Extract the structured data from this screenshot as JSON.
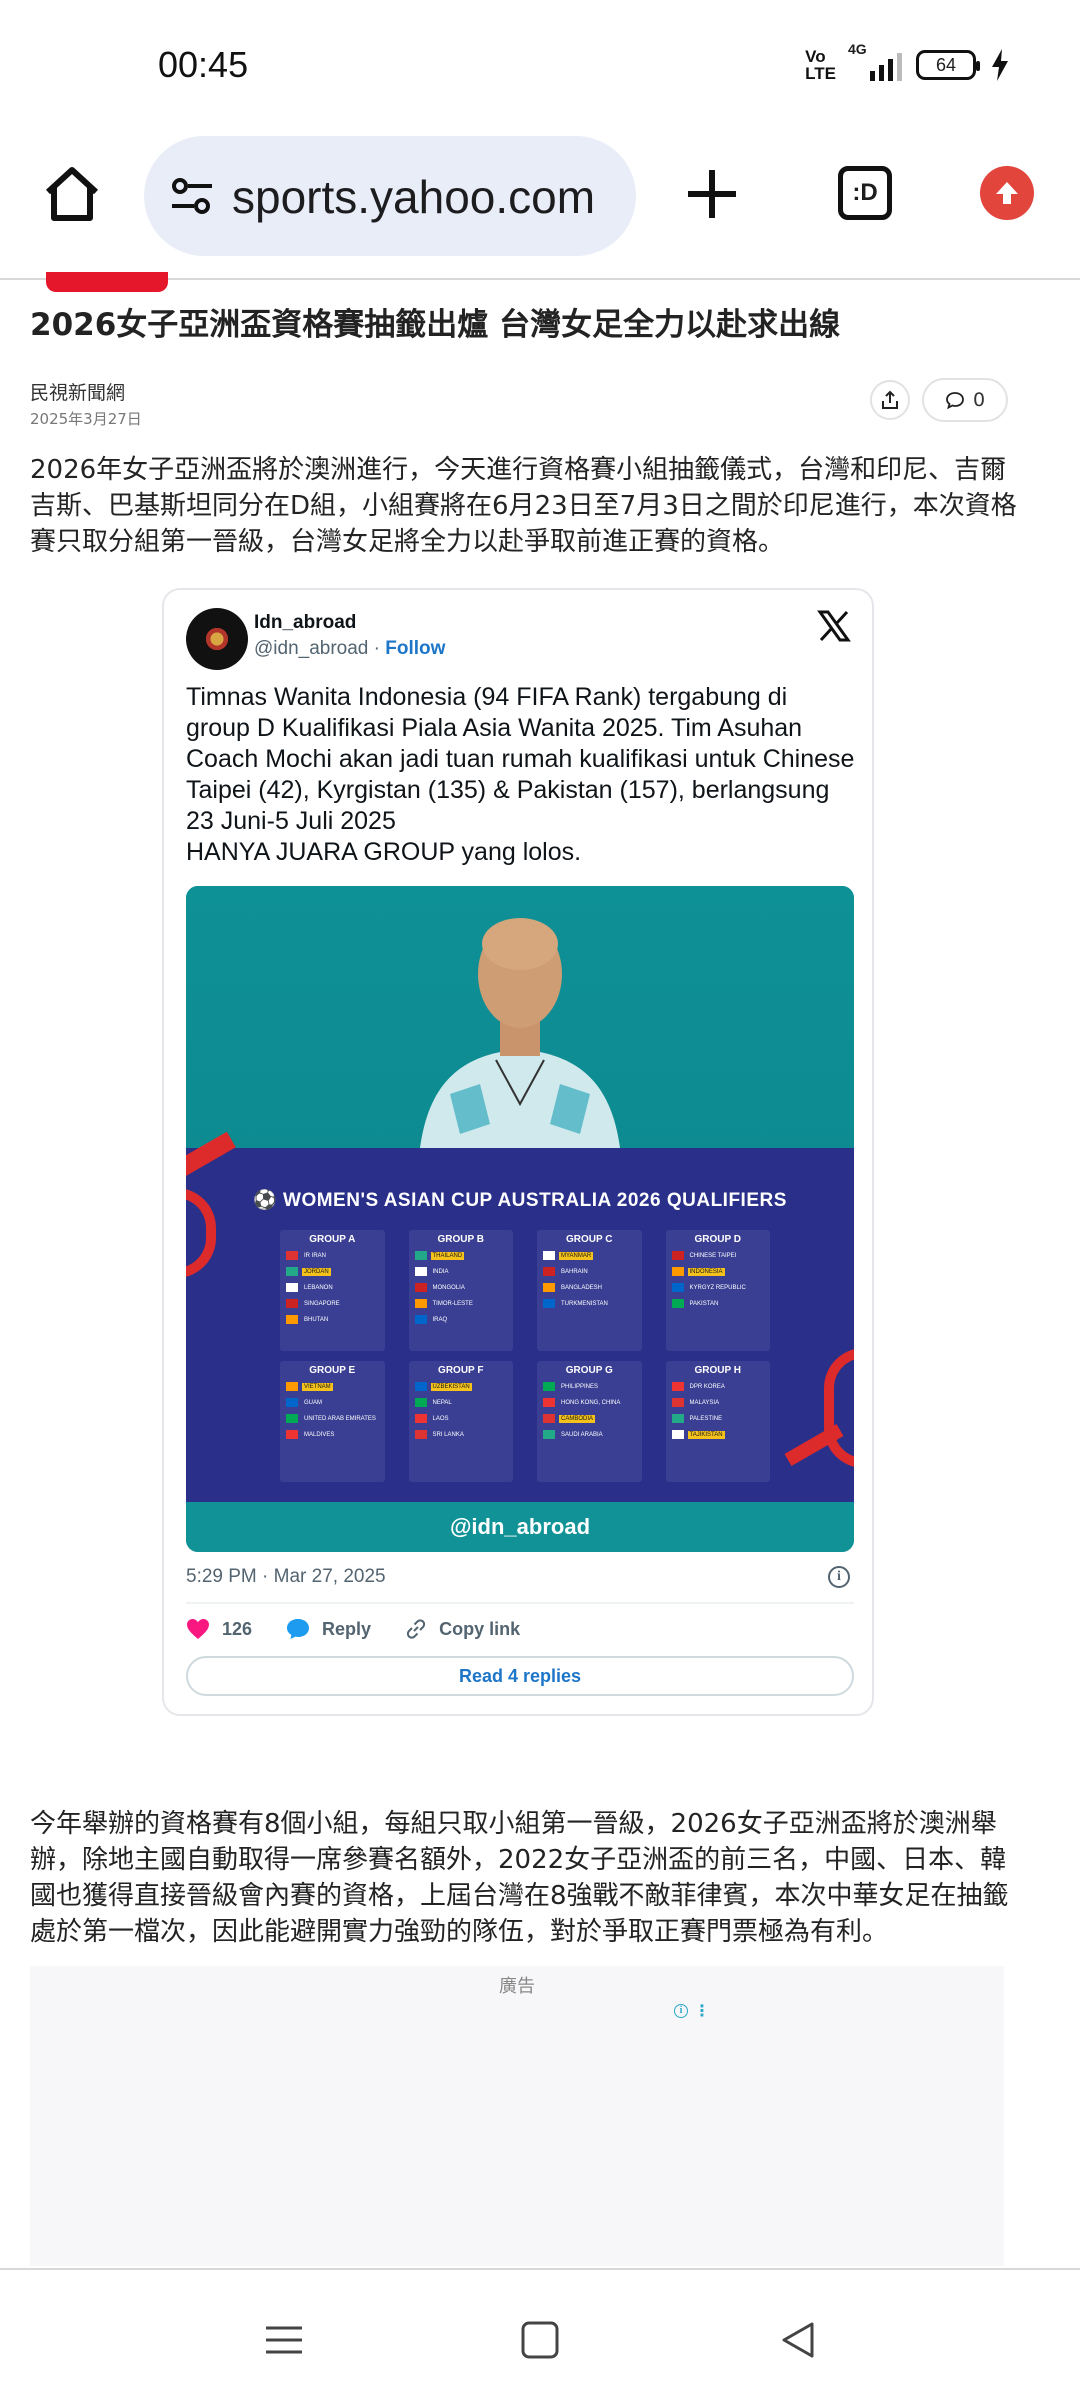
{
  "status_bar": {
    "time": "00:45",
    "volte_line1": "Vo",
    "volte_line2": "LTE",
    "network": "4G",
    "battery": "64"
  },
  "browser": {
    "url": "sports.yahoo.com",
    "tabs_label": ":D",
    "icons": [
      "home-icon",
      "site-settings-icon",
      "new-tab-icon",
      "tabs-icon",
      "update-icon"
    ]
  },
  "article": {
    "title": "2026女子亞洲盃資格賽抽籤出爐 台灣女足全力以赴求出線",
    "publisher": "民視新聞網",
    "date": "2025年3月27日",
    "comment_count": "0",
    "paragraph1": "2026年女子亞洲盃將於澳洲進行，今天進行資格賽小組抽籤儀式，台灣和印尼、吉爾吉斯、巴基斯坦同分在D組，小組賽將在6月23日至7月3日之間於印尼進行，本次資格賽只取分組第一晉級，台灣女足將全力以赴爭取前進正賽的資格。",
    "paragraph2": "今年舉辦的資格賽有8個小組，每組只取小組第一晉級，2026女子亞洲盃將於澳洲舉辦，除地主國自動取得一席參賽名額外，2022女子亞洲盃的前三名，中國、日本、韓國也獲得直接晉級會內賽的資格，上屆台灣在8強戰不敵菲律賓，本次中華女足在抽籤處於第一檔次，因此能避開實力強勁的隊伍，對於爭取正賽門票極為有利。"
  },
  "tweet": {
    "name": "Idn_abroad",
    "handle": "@idn_abroad",
    "separator": " · ",
    "follow": "Follow",
    "text": "Timnas Wanita Indonesia (94 FIFA Rank)  tergabung di group D Kualifikasi Piala Asia Wanita 2025. Tim Asuhan Coach Mochi akan jadi tuan rumah kualifikasi untuk Chinese Taipei (42), Kyrgistan (135) & Pakistan (157), berlangsung 23 Juni-5 Juli 2025\nHANYA JUARA GROUP yang lolos.",
    "image": {
      "title": "WOMEN'S ASIAN CUP AUSTRALIA 2026 QUALIFIERS",
      "watermark": "@idn_abroad",
      "groups": [
        {
          "name": "GROUP A",
          "teams": [
            {
              "n": "IR IRAN",
              "hl": false
            },
            {
              "n": "JORDAN",
              "hl": true
            },
            {
              "n": "LEBANON",
              "hl": false
            },
            {
              "n": "SINGAPORE",
              "hl": false
            },
            {
              "n": "BHUTAN",
              "hl": false
            }
          ]
        },
        {
          "name": "GROUP B",
          "teams": [
            {
              "n": "THAILAND",
              "hl": true
            },
            {
              "n": "INDIA",
              "hl": false
            },
            {
              "n": "MONGOLIA",
              "hl": false
            },
            {
              "n": "TIMOR-LESTE",
              "hl": false
            },
            {
              "n": "IRAQ",
              "hl": false
            }
          ]
        },
        {
          "name": "GROUP C",
          "teams": [
            {
              "n": "MYANMAR",
              "hl": true
            },
            {
              "n": "BAHRAIN",
              "hl": false
            },
            {
              "n": "BANGLADESH",
              "hl": false
            },
            {
              "n": "TURKMENISTAN",
              "hl": false
            }
          ]
        },
        {
          "name": "GROUP D",
          "teams": [
            {
              "n": "CHINESE TAIPEI",
              "hl": false
            },
            {
              "n": "INDONESIA",
              "hl": true
            },
            {
              "n": "KYRGYZ REPUBLIC",
              "hl": false
            },
            {
              "n": "PAKISTAN",
              "hl": false
            }
          ]
        },
        {
          "name": "GROUP E",
          "teams": [
            {
              "n": "VIETNAM",
              "hl": true
            },
            {
              "n": "GUAM",
              "hl": false
            },
            {
              "n": "UNITED ARAB EMIRATES",
              "hl": false
            },
            {
              "n": "MALDIVES",
              "hl": false
            }
          ]
        },
        {
          "name": "GROUP F",
          "teams": [
            {
              "n": "UZBEKISTAN",
              "hl": true
            },
            {
              "n": "NEPAL",
              "hl": false
            },
            {
              "n": "LAOS",
              "hl": false
            },
            {
              "n": "SRI LANKA",
              "hl": false
            }
          ]
        },
        {
          "name": "GROUP G",
          "teams": [
            {
              "n": "PHILIPPINES",
              "hl": false
            },
            {
              "n": "HONG KONG, CHINA",
              "hl": false
            },
            {
              "n": "CAMBODIA",
              "hl": true
            },
            {
              "n": "SAUDI ARABIA",
              "hl": false
            }
          ]
        },
        {
          "name": "GROUP H",
          "teams": [
            {
              "n": "DPR KOREA",
              "hl": false
            },
            {
              "n": "MALAYSIA",
              "hl": false
            },
            {
              "n": "PALESTINE",
              "hl": false
            },
            {
              "n": "TAJIKISTAN",
              "hl": true
            }
          ]
        }
      ]
    },
    "timestamp": "5:29 PM · Mar 27, 2025",
    "likes": "126",
    "reply": "Reply",
    "copy_link": "Copy link",
    "read_replies": "Read 4 replies"
  },
  "ad": {
    "label": "廣告"
  },
  "nav_bar": {
    "icons": [
      "menu-icon",
      "home-square-icon",
      "back-icon"
    ]
  },
  "colors": {
    "accent_blue": "#1d76c8",
    "update_red": "#e2453c",
    "url_bar": "#e8edf8",
    "like_pink": "#f91880"
  }
}
